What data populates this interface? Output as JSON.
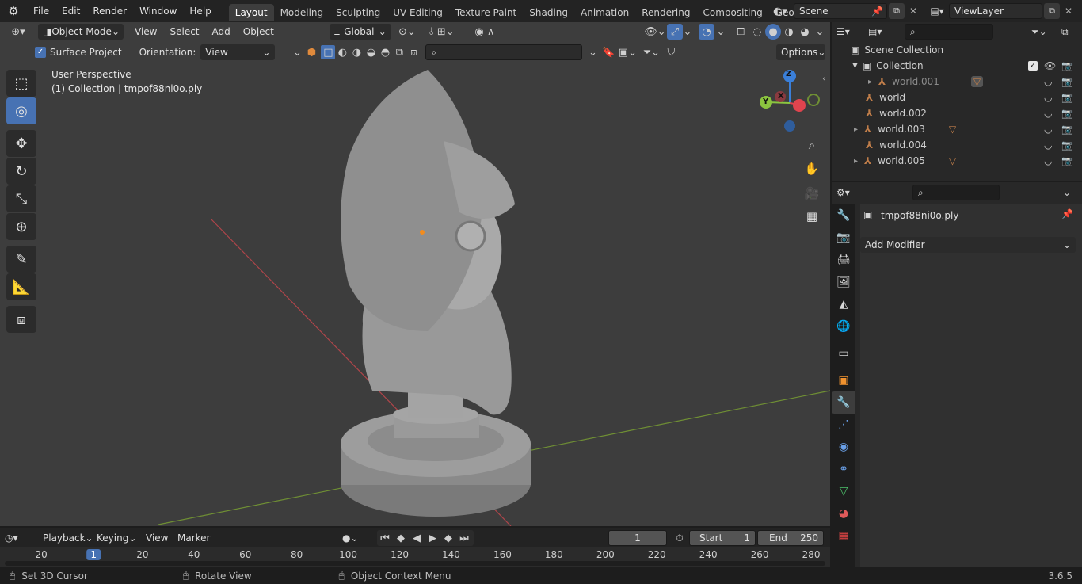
{
  "app": {
    "menus": [
      "File",
      "Edit",
      "Render",
      "Window",
      "Help"
    ],
    "workspaces": [
      "Layout",
      "Modeling",
      "Sculpting",
      "UV Editing",
      "Texture Paint",
      "Shading",
      "Animation",
      "Rendering",
      "Compositing",
      "Geometry Noc"
    ],
    "active_workspace": "Layout",
    "scene_name": "Scene",
    "view_layer": "ViewLayer",
    "version": "3.6.5"
  },
  "viewport_header": {
    "mode": "Object Mode",
    "menus": [
      "View",
      "Select",
      "Add",
      "Object"
    ],
    "transform_orientation": "Global",
    "surface_project_label": "Surface Project",
    "surface_project_checked": true,
    "orientation_label": "Orientation:",
    "orientation_value": "View",
    "options_label": "Options"
  },
  "viewport_overlay": {
    "perspective": "User Perspective",
    "collection_info": "(1) Collection | tmpof88ni0o.ply"
  },
  "gizmo": {
    "x": "X",
    "y": "Y",
    "z": "Z"
  },
  "outliner": {
    "root": "Scene Collection",
    "collection": "Collection",
    "items": [
      {
        "name": "world.001",
        "expandable": true,
        "has_mesh_badge": true,
        "dim": true
      },
      {
        "name": "world",
        "expandable": false,
        "has_mesh_badge": false,
        "dim": false
      },
      {
        "name": "world.002",
        "expandable": false,
        "has_mesh_badge": false,
        "dim": false
      },
      {
        "name": "world.003",
        "expandable": true,
        "has_mesh_badge": true,
        "dim": false
      },
      {
        "name": "world.004",
        "expandable": false,
        "has_mesh_badge": false,
        "dim": false
      },
      {
        "name": "world.005",
        "expandable": true,
        "has_mesh_badge": true,
        "dim": false
      }
    ]
  },
  "properties": {
    "object_name": "tmpof88ni0o.ply",
    "add_modifier_label": "Add Modifier"
  },
  "timeline": {
    "menus": [
      "Playback",
      "Keying",
      "View",
      "Marker"
    ],
    "current_frame": "1",
    "start_label": "Start",
    "start_value": "1",
    "end_label": "End",
    "end_value": "250",
    "ticks": [
      "-20",
      "1",
      "20",
      "40",
      "60",
      "80",
      "100",
      "120",
      "140",
      "160",
      "180",
      "200",
      "220",
      "240",
      "260",
      "280"
    ],
    "tick_positions_frames": [
      -20,
      1,
      20,
      40,
      60,
      80,
      100,
      120,
      140,
      160,
      180,
      200,
      220,
      240,
      260,
      280
    ]
  },
  "statusbar": {
    "left": "Set 3D Cursor",
    "middle": "Rotate View",
    "right": "Object Context Menu"
  },
  "colors": {
    "accent": "#4772b3",
    "x_axis": "#e0444e",
    "y_axis": "#8bc43f",
    "z_axis": "#3a7fd9",
    "mesh_orange": "#c17e4a"
  }
}
